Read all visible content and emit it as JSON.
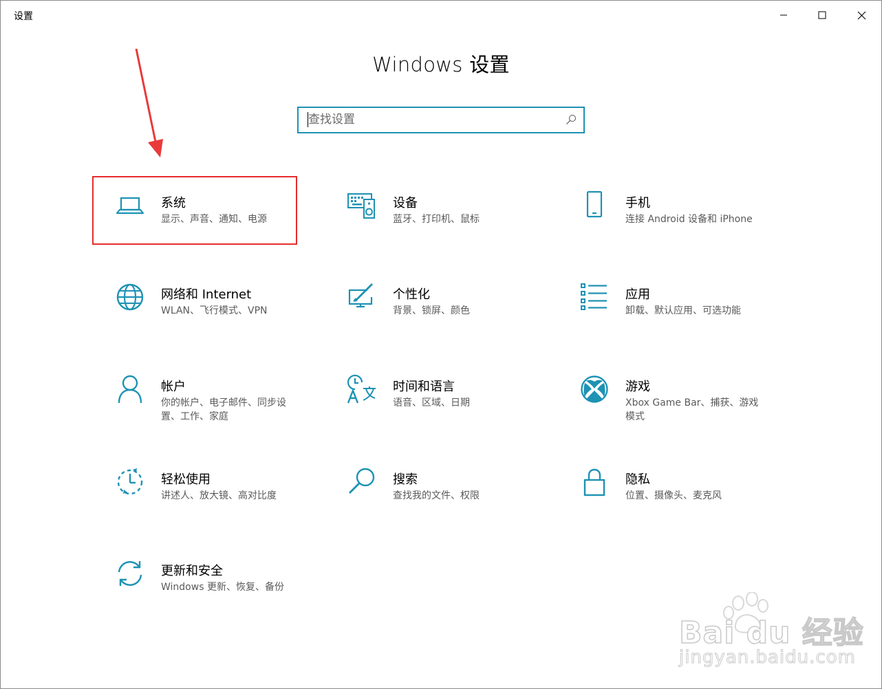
{
  "window": {
    "app_title": "设置",
    "page_title": "Windows 设置"
  },
  "search": {
    "placeholder": "查找设置"
  },
  "accent_color": "#1e92b4",
  "highlight_color": "#e52d2d",
  "tiles": [
    {
      "label": "系统",
      "desc": "显示、声音、通知、电源",
      "icon": "laptop-icon"
    },
    {
      "label": "设备",
      "desc": "蓝牙、打印机、鼠标",
      "icon": "devices-icon"
    },
    {
      "label": "手机",
      "desc": "连接 Android 设备和 iPhone",
      "icon": "phone-icon"
    },
    {
      "label": "网络和 Internet",
      "desc": "WLAN、飞行模式、VPN",
      "icon": "globe-icon"
    },
    {
      "label": "个性化",
      "desc": "背景、锁屏、颜色",
      "icon": "paint-icon"
    },
    {
      "label": "应用",
      "desc": "卸载、默认应用、可选功能",
      "icon": "apps-list-icon"
    },
    {
      "label": "帐户",
      "desc": "你的帐户、电子邮件、同步设置、工作、家庭",
      "icon": "person-icon"
    },
    {
      "label": "时间和语言",
      "desc": "语音、区域、日期",
      "icon": "time-language-icon"
    },
    {
      "label": "游戏",
      "desc": "Xbox Game Bar、捕获、游戏模式",
      "icon": "xbox-icon"
    },
    {
      "label": "轻松使用",
      "desc": "讲述人、放大镜、高对比度",
      "icon": "ease-of-access-icon"
    },
    {
      "label": "搜索",
      "desc": "查找我的文件、权限",
      "icon": "search-icon"
    },
    {
      "label": "隐私",
      "desc": "位置、摄像头、麦克风",
      "icon": "lock-icon"
    },
    {
      "label": "更新和安全",
      "desc": "Windows 更新、恢复、备份",
      "icon": "sync-icon"
    }
  ],
  "watermark": {
    "brand": "Bai du 经验",
    "url": "jingyan.baidu.com"
  }
}
